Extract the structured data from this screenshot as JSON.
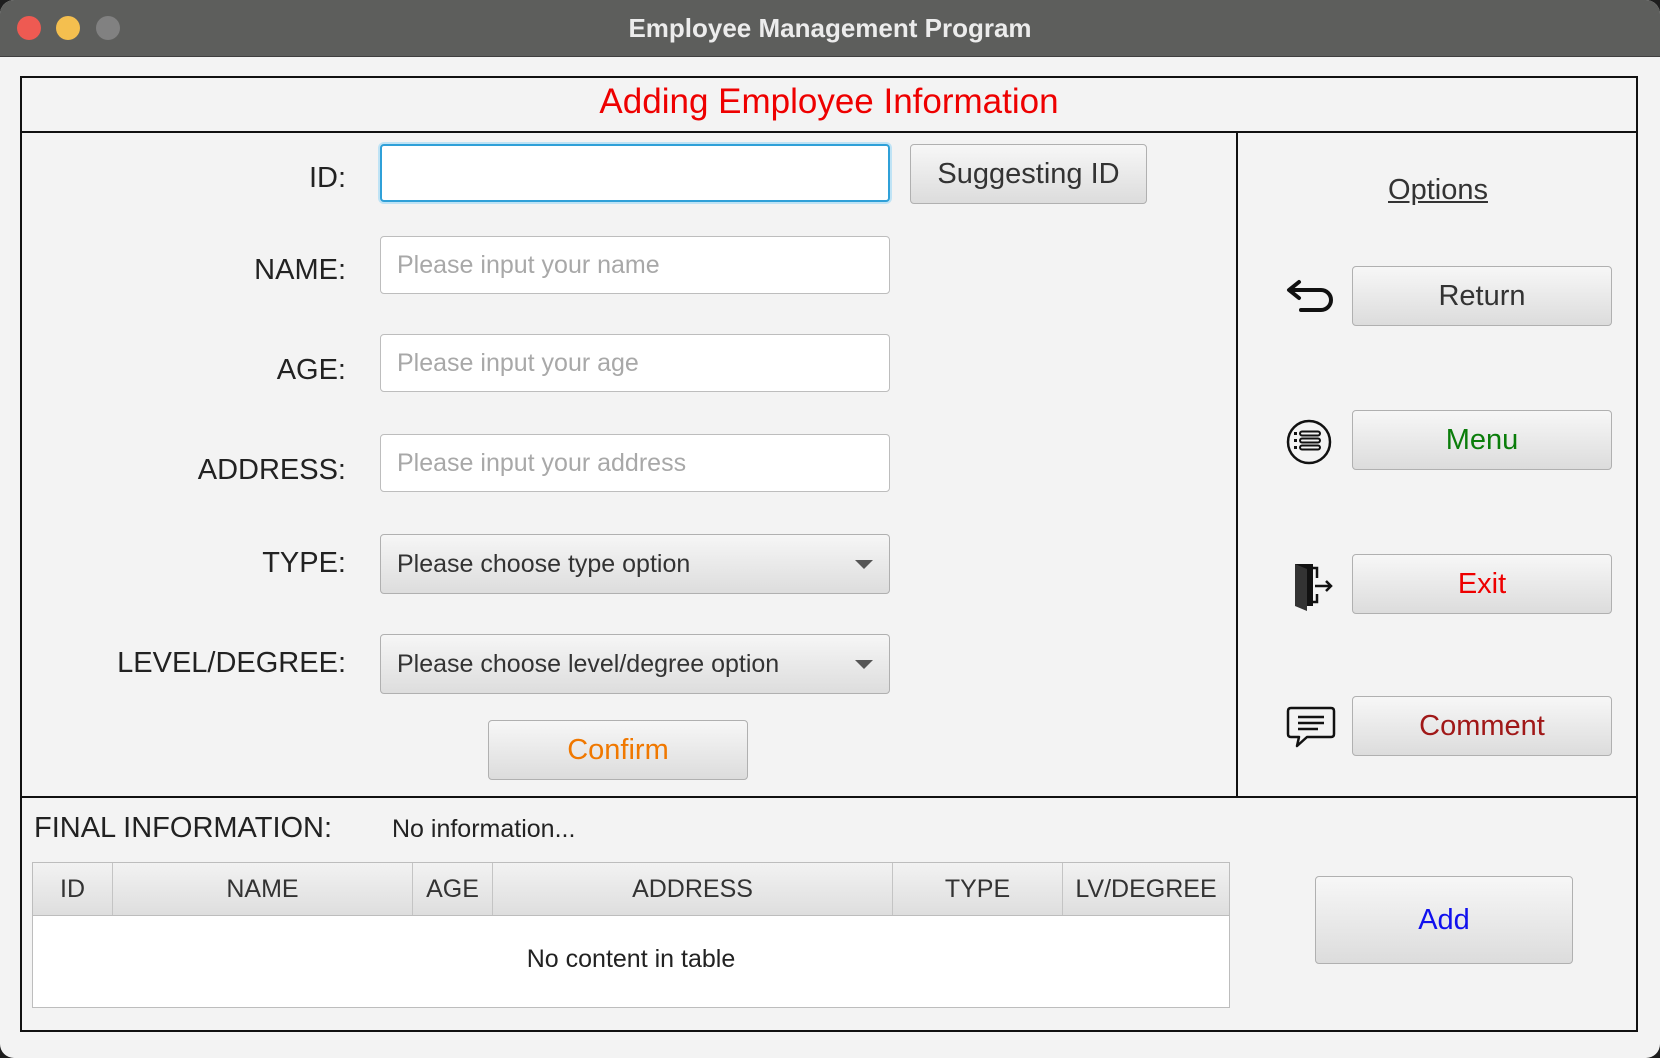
{
  "window": {
    "title": "Employee Management Program"
  },
  "heading": "Adding Employee Information",
  "form": {
    "id_label": "ID:",
    "id_value": "",
    "suggest_button": "Suggesting ID",
    "name_label": "NAME:",
    "name_placeholder": "Please input your name",
    "age_label": "AGE:",
    "age_placeholder": "Please input your age",
    "address_label": "ADDRESS:",
    "address_placeholder": "Please input your address",
    "type_label": "TYPE:",
    "type_selected": "Please choose type option",
    "level_label": "LEVEL/DEGREE:",
    "level_selected": "Please choose level/degree option",
    "confirm_button": "Confirm"
  },
  "options": {
    "title": "Options",
    "items": [
      {
        "label": "Return",
        "icon": "return-arrow-icon",
        "color": "#333333"
      },
      {
        "label": "Menu",
        "icon": "list-menu-icon",
        "color": "#0a7d0a"
      },
      {
        "label": "Exit",
        "icon": "exit-door-icon",
        "color": "#ee0000"
      },
      {
        "label": "Comment",
        "icon": "comment-bubble-icon",
        "color": "#a01818"
      }
    ]
  },
  "final": {
    "label": "FINAL INFORMATION:",
    "value": "No information..."
  },
  "table": {
    "columns": [
      "ID",
      "NAME",
      "AGE",
      "ADDRESS",
      "TYPE",
      "LV/DEGREE"
    ],
    "empty_message": "No content in table"
  },
  "add_button": "Add",
  "colors": {
    "heading": "#ee0000",
    "confirm": "#f07800",
    "add": "#1010ee"
  }
}
